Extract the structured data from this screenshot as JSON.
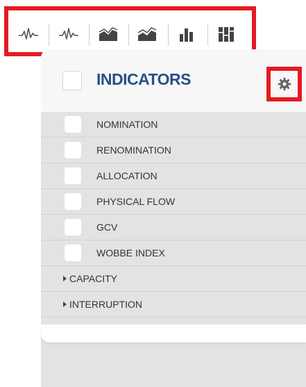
{
  "toolbar": {
    "tools": [
      {
        "icon": "line-chart-icon"
      },
      {
        "icon": "line-chart-alt-icon"
      },
      {
        "icon": "area-chart-icon"
      },
      {
        "icon": "area-chart-alt-icon"
      },
      {
        "icon": "bar-chart-icon"
      },
      {
        "icon": "stacked-bar-chart-icon"
      }
    ],
    "highlight_color": "#e31b23"
  },
  "panel": {
    "title": "INDICATORS",
    "settings_icon": "gear-icon",
    "items": [
      {
        "label": "NOMINATION"
      },
      {
        "label": "RENOMINATION"
      },
      {
        "label": "ALLOCATION"
      },
      {
        "label": "PHYSICAL FLOW"
      },
      {
        "label": "GCV"
      },
      {
        "label": "WOBBE INDEX"
      }
    ],
    "groups": [
      {
        "label": "CAPACITY"
      },
      {
        "label": "INTERRUPTION"
      }
    ],
    "title_color": "#2a4f8a"
  }
}
